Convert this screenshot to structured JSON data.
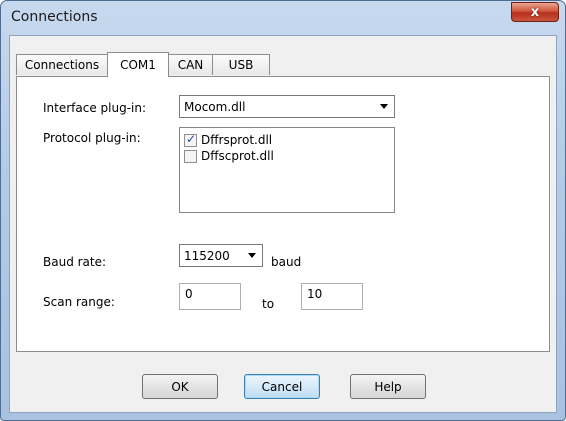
{
  "window": {
    "title": "Connections",
    "close_glyph": "x"
  },
  "tabs": [
    {
      "label": "Connections",
      "active": false
    },
    {
      "label": "COM1",
      "active": true
    },
    {
      "label": "CAN",
      "active": false
    },
    {
      "label": "USB",
      "active": false
    }
  ],
  "form": {
    "interface_label": "Interface plug-in:",
    "interface_value": "Mocom.dll",
    "protocol_label": "Protocol plug-in:",
    "protocol_items": [
      {
        "label": "Dffrsprot.dll",
        "checked": true
      },
      {
        "label": "Dffscprot.dll",
        "checked": false
      }
    ],
    "baud_label": "Baud rate:",
    "baud_value": "115200",
    "baud_unit": "baud",
    "scan_label": "Scan range:",
    "scan_from": "0",
    "scan_to_label": "to",
    "scan_to": "10"
  },
  "buttons": {
    "ok": "OK",
    "cancel": "Cancel",
    "help": "Help"
  },
  "colors": {
    "titlebar": "#b4cbe6",
    "close": "#c9553f",
    "default_button_border": "#3c7fb1"
  }
}
